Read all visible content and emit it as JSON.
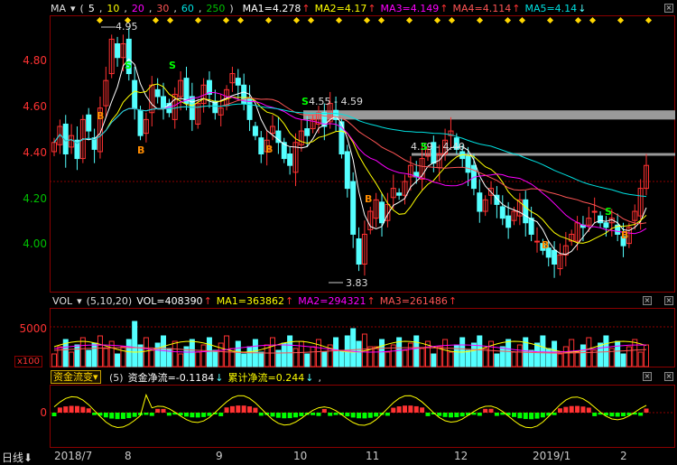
{
  "colors": {
    "up": "#ff3232",
    "down": "#54ffff",
    "ma1": "#ffffff",
    "ma2": "#ffff00",
    "ma3": "#ff00ff",
    "ma4": "#ff5555",
    "ma5": "#00e0e0",
    "buy": "#ff8c00",
    "sell": "#00ff00",
    "grid": "#8b0000"
  },
  "main": {
    "indicator": "MA",
    "params_prefix": "(",
    "params": [
      "5",
      "10",
      "20",
      "30",
      "60",
      "250"
    ],
    "params_suffix": ")",
    "ma1": "MA1=4.278",
    "ma2": "MA2=4.17",
    "ma3": "MA3=4.149",
    "ma4": "MA4=4.114",
    "ma5": "MA5=4.14",
    "y_ticks": [
      "4.80",
      "4.60",
      "4.40",
      "4.20",
      "4.00"
    ],
    "high_label": "4.95",
    "low_label": "3.83",
    "zone1_label": "4.55 - 4.59",
    "zone2_label": "4.39 - 4.40",
    "buy_label": "B",
    "sell_label": "S"
  },
  "vol": {
    "indicator": "VOL",
    "params": "(5,10,20)",
    "vol": "VOL=408390",
    "ma1": "MA1=363862",
    "ma2": "MA2=294321",
    "ma3": "MA3=261486",
    "y_tick": "5000",
    "unit": "x100"
  },
  "flow": {
    "indicator": "资金流变",
    "params": "(5)",
    "net": "资金净流=-0.1184",
    "cum": "累计净流=0.244",
    "y_tick": "0"
  },
  "xaxis": {
    "period": "日线",
    "labels": [
      "2018/7",
      "8",
      "9",
      "10",
      "11",
      "12",
      "2019/1",
      "2"
    ]
  },
  "chart_data": {
    "type": "candlestick",
    "y_range": [
      3.8,
      5.0
    ],
    "x_labels": [
      "2018/7",
      "8",
      "9",
      "10",
      "11",
      "12",
      "2019/1",
      "2"
    ],
    "closes": [
      4.45,
      4.52,
      4.4,
      4.48,
      4.38,
      4.55,
      4.5,
      4.42,
      4.6,
      4.72,
      4.9,
      4.82,
      4.88,
      4.75,
      4.6,
      4.48,
      4.55,
      4.7,
      4.65,
      4.6,
      4.58,
      4.66,
      4.72,
      4.62,
      4.55,
      4.62,
      4.7,
      4.66,
      4.58,
      4.6,
      4.68,
      4.75,
      4.7,
      4.62,
      4.55,
      4.48,
      4.4,
      4.46,
      4.52,
      4.45,
      4.38,
      4.35,
      4.45,
      4.5,
      4.48,
      4.55,
      4.58,
      4.52,
      4.62,
      4.55,
      4.4,
      4.25,
      4.05,
      3.92,
      4.05,
      4.15,
      4.2,
      4.1,
      4.18,
      4.25,
      4.22,
      4.28,
      4.35,
      4.3,
      4.38,
      4.42,
      4.36,
      4.4,
      4.46,
      4.5,
      4.42,
      4.38,
      4.32,
      4.25,
      4.15,
      4.2,
      4.25,
      4.18,
      4.12,
      4.08,
      4.15,
      4.2,
      4.1,
      4.05,
      4.02,
      3.98,
      3.95,
      3.92,
      3.96,
      4.0,
      4.05,
      4.1,
      4.08,
      4.12,
      4.15,
      4.1,
      4.08,
      4.12,
      4.05,
      4.0,
      4.08,
      4.15,
      4.25,
      4.35
    ]
  }
}
